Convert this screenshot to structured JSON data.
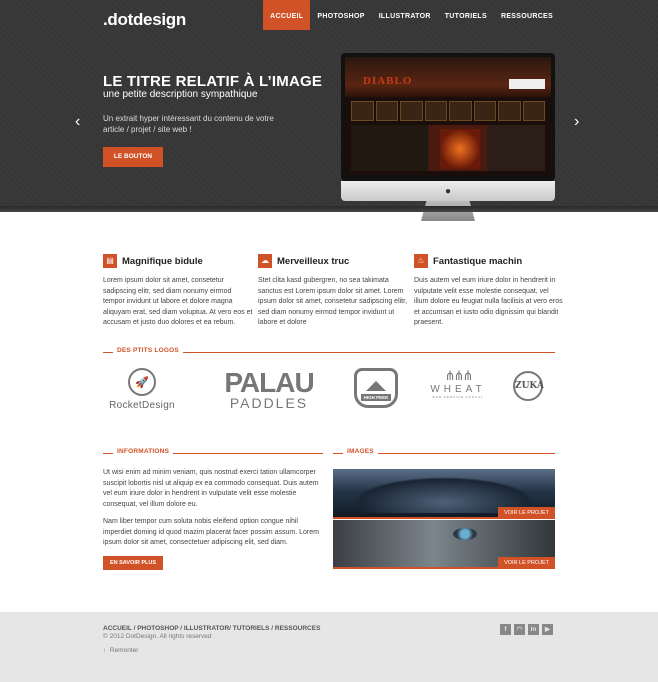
{
  "header": {
    "logo": ".dotdesign",
    "nav": [
      "ACCUEIL",
      "PHOTOSHOP",
      "ILLUSTRATOR",
      "TUTORIELS",
      "RESSOURCES"
    ],
    "active_nav": "ACCUEIL"
  },
  "hero": {
    "title": "LE TITRE RELATIF À L’IMAGE",
    "subtitle": "une petite description sympathique",
    "text": "Un extrait hyper intéressant du contenu de votre article / projet / site web !",
    "button": "LE BOUTON",
    "prev_arrow": "‹",
    "next_arrow": "›",
    "screen_title": "DIABLO"
  },
  "features": [
    {
      "title": "Magnifique bidule",
      "icon": "book-icon",
      "text": "Lorem ipsum dolor sit amet, consetetur sadipscing elitr, sed diam nonumy eirmod tempor invidunt ut labore et dolore magna aliquyam erat, sed diam voluptua. At vero eos et accusam et justo duo dolores et ea rebum."
    },
    {
      "title": "Merveilleux truc",
      "icon": "cloud-icon",
      "text": "Stet clita kasd gubergren, no sea takimata sanctus est Lorem ipsum dolor sit amet. Lorem ipsum dolor sit amet, consetetur sadipscing elitr, sed diam nonumy eirmod tempor invidunt ut labore et dolore"
    },
    {
      "title": "Fantastique machin",
      "icon": "flame-icon",
      "text": "Duis autem vel eum iriure dolor in hendrerit in vulputate velit esse molestie consequat, vel illum dolore eu feugiat nulla facilisis at vero eros et accumsan et iusto odio dignissim qui blandit praesent."
    }
  ],
  "logos_section": {
    "label": "DES PTITS LOGOS",
    "rocket": "RocketDesign",
    "palau_top": "PALAU",
    "palau_bottom": "PADDLES",
    "highpeek": "HIGH PEEK",
    "wheat": "WHEAT",
    "wheat_sub": "WEB SERVICE ANNUAL",
    "zuka": "ZUKA"
  },
  "info": {
    "label": "INFORMATIONS",
    "p1": "Ut wisi enim ad minim veniam, quis nostrud exerci tation ullamcorper suscipit lobortis nisl ut aliquip ex ea commodo consequat. Duis autem vel eum iriure dolor in hendrerit in vulputate velit esse molestie consequat, vel illum dolore eu.",
    "p2": "Nam liber tempor cum soluta nobis eleifend option congue nihil imperdiet doming id quod mazim placerat facer possim assum. Lorem ipsum dolor sit amet, consectetuer adipiscing elit, sed diam.",
    "button": "EN SAVOIR PLUS"
  },
  "images": {
    "label": "IMAGES",
    "btn1": "VOIR LE PROJET",
    "btn2": "VOIR LE PROJET"
  },
  "footer": {
    "links": "ACCUEIL / PHOTOSHOP / ILLUSTRATOR/ TUTORIELS / RESSOURCES",
    "copyright": "© 2012 DotDesign. All rights reserved",
    "back_to_top": "Remonter",
    "socials": [
      "f",
      "rss",
      "in",
      "yt"
    ]
  },
  "colors": {
    "accent": "#d25227",
    "hero_bg": "#3a3a3a",
    "footer_bg": "#e6e6e6"
  }
}
